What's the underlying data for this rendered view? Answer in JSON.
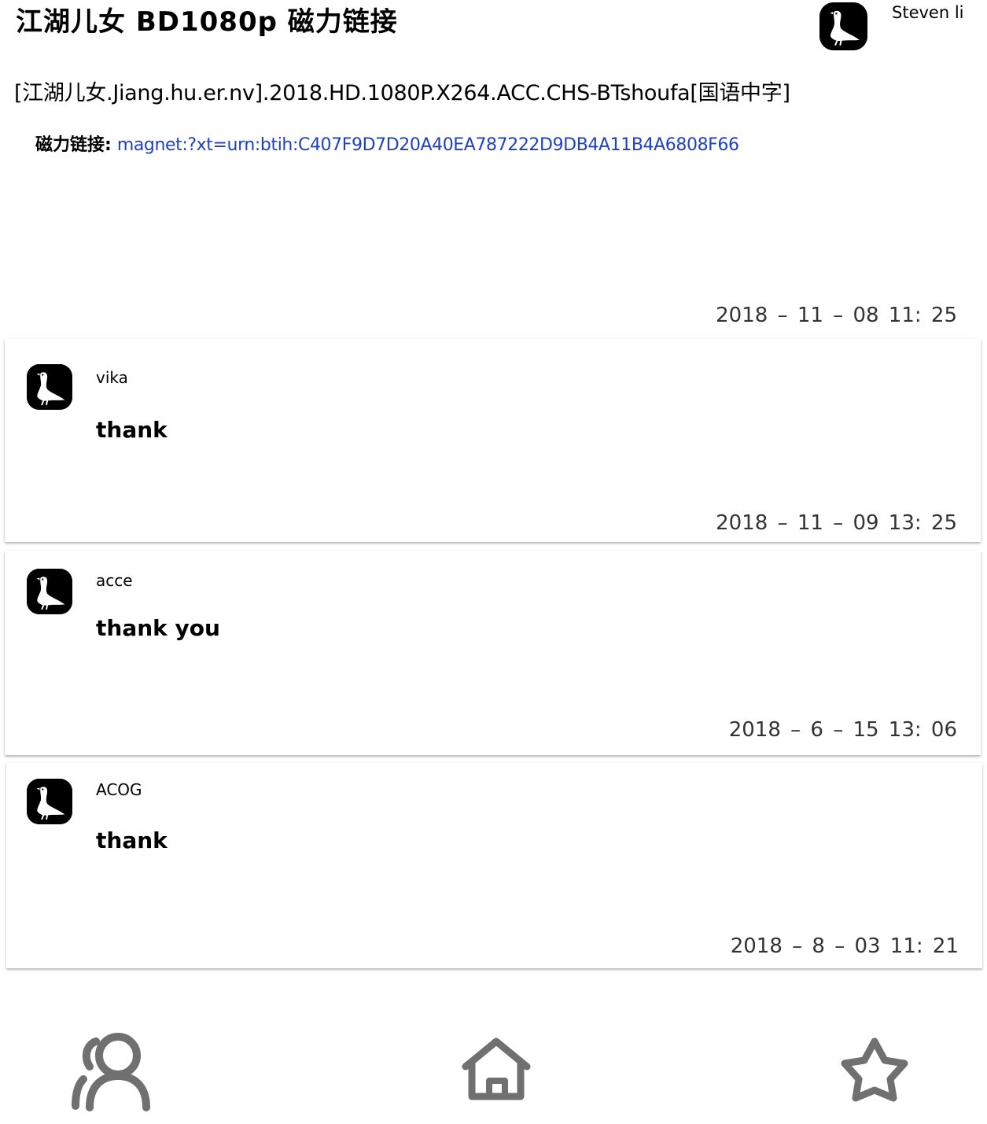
{
  "post": {
    "title": "江湖儿女 BD1080p 磁力链接",
    "author": "Steven li",
    "file_name": "[江湖儿女.Jiang.hu.er.nv].2018.HD.1080P.X264.ACC.CHS-BTshoufa[国语中字]",
    "magnet_label": "磁力链接:",
    "magnet_link": "magnet:?xt=urn:btih:C407F9D7D20A40EA787222D9DB4A11B4A6808F66",
    "date": "2018 – 11 – 08   11: 25"
  },
  "comments": [
    {
      "user": "vika",
      "text": "thank",
      "date": "2018 – 11 – 09   13: 25"
    },
    {
      "user": "acce",
      "text": "thank you",
      "date": "2018 – 6 – 15   13: 06"
    },
    {
      "user": "ACOG",
      "text": "thank",
      "date": "2018 – 8 – 03   11: 21"
    }
  ],
  "nav": {
    "items": [
      {
        "icon": "users-icon"
      },
      {
        "icon": "home-icon"
      },
      {
        "icon": "star-icon"
      }
    ],
    "icon_color": "#707070"
  },
  "colors": {
    "link": "#1f3fc4",
    "avatar_bg": "#000000"
  }
}
